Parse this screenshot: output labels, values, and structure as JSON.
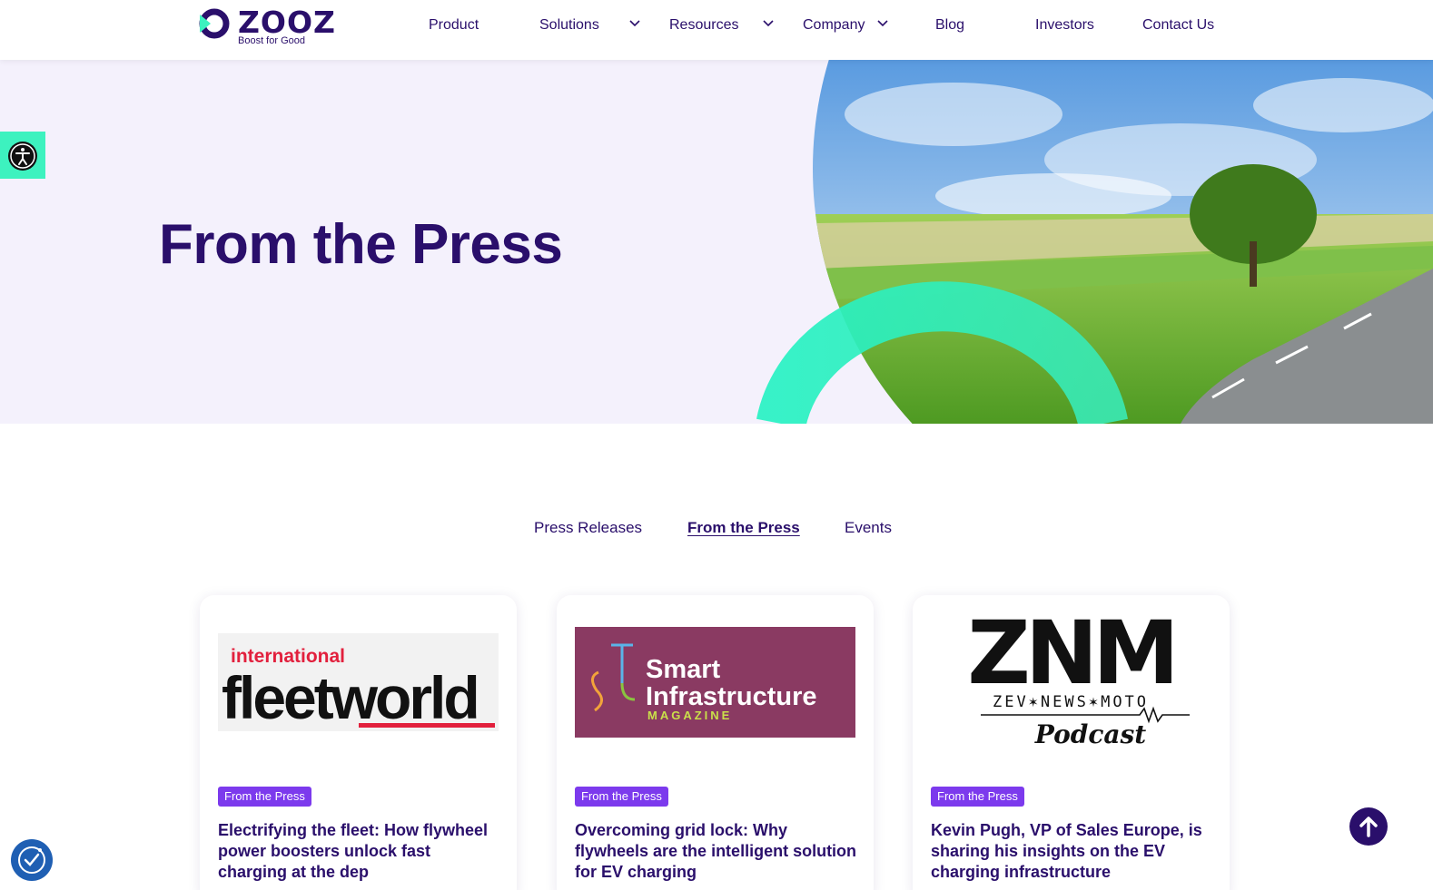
{
  "header": {
    "logo": {
      "wordmark": "ZOOZ",
      "tagline": "Boost for Good"
    },
    "nav": [
      {
        "label": "Product"
      },
      {
        "label": "Solutions"
      },
      {
        "label": "Resources"
      },
      {
        "label": "Company"
      },
      {
        "label": "Blog"
      },
      {
        "label": "Investors"
      },
      {
        "label": "Contact Us"
      }
    ]
  },
  "hero": {
    "title": "From the Press"
  },
  "tabs": [
    {
      "label": "Press Releases",
      "active": false
    },
    {
      "label": "From the Press",
      "active": true
    },
    {
      "label": "Events",
      "active": false
    }
  ],
  "cards": [
    {
      "logo_text": [
        "international",
        "fleetworld"
      ],
      "badge": "From the Press",
      "title": "Electrifying the fleet: How flywheel power boosters unlock fast charging at the dep"
    },
    {
      "logo_text": [
        "Smart",
        "Infrastructure",
        "MAGAZINE"
      ],
      "badge": "From the Press",
      "title": "Overcoming grid lock: Why flywheels are the intelligent solution for EV charging"
    },
    {
      "logo_text": [
        "ZNM",
        "ZEV✶NEWS✶MOTO",
        "Podcast"
      ],
      "badge": "From the Press",
      "title": "Kevin Pugh, VP of Sales Europe, is sharing his insights on the EV charging infrastructure"
    }
  ],
  "icons": {
    "accessibility": "accessibility-icon",
    "scroll_top": "arrow-up-icon",
    "consent": "cookie-consent-icon"
  },
  "colors": {
    "brand_navy": "#2a0f6b",
    "accent_green": "#3df2bf",
    "badge_purple": "#7c3aed",
    "hero_bg": "#f4f1fc"
  }
}
